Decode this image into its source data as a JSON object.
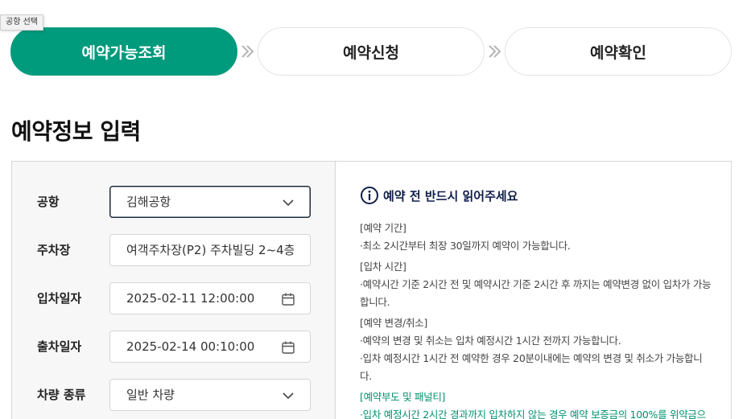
{
  "tooltip": "공항 선택",
  "steps": [
    {
      "label": "예약가능조회",
      "active": true
    },
    {
      "label": "예약신청",
      "active": false
    },
    {
      "label": "예약확인",
      "active": false
    }
  ],
  "section_title": "예약정보 입력",
  "form": {
    "airport": {
      "label": "공항",
      "value": "김해공항",
      "icon": "chevron-down-icon"
    },
    "parking": {
      "label": "주차장",
      "value": "여객주차장(P2) 주차빌딩 2~4층"
    },
    "entry": {
      "label": "입차일자",
      "value": "2025-02-11 12:00:00",
      "icon": "calendar-icon"
    },
    "exit": {
      "label": "출차일자",
      "value": "2025-02-14 00:10:00",
      "icon": "calendar-icon"
    },
    "vehicle": {
      "label": "차량 종류",
      "value": "일반 차량",
      "icon": "chevron-down-icon"
    }
  },
  "notice": {
    "title": "예약 전 반드시 읽어주세요",
    "period_head": "[예약 기간]",
    "period_1": "·최소 2시간부터 최장 30일까지 예약이 가능합니다.",
    "entry_head": "[입차 시간]",
    "entry_1": "·예약시간 기준 2시간 전 및 예약시간 기준 2시간 후 까지는 예약변경 없이 입차가 가능합니다.",
    "change_head": "[예약 변경/취소]",
    "change_1": "·예약의 변경 및 취소는 입차 예정시간 1시간 전까지 가능합니다.",
    "change_2": "·입차 예정시간 1시간 전 예약한 경우 20분이내에는 예약의 변경 및 취소가 가능합니다.",
    "penalty_head": "[예약부도 및 패널티]",
    "penalty_1": "·입차 예정시간 2시간 경과까지 입차하지 않는 경우 예약 보증금의 100%를 위약금으"
  },
  "colors": {
    "accent": "#009a7c",
    "notice_title": "#0f1e4a",
    "penalty": "#00926f"
  }
}
